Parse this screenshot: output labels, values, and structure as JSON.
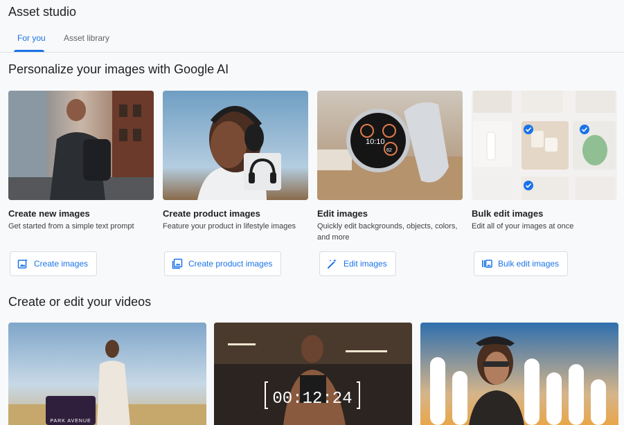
{
  "app": {
    "title": "Asset studio"
  },
  "tabs": [
    {
      "label": "For you",
      "active": true
    },
    {
      "label": "Asset library",
      "active": false
    }
  ],
  "images_section": {
    "title": "Personalize your images with Google AI",
    "cards": [
      {
        "title": "Create new images",
        "description": "Get started from a simple text prompt",
        "button": "Create images",
        "icon": "image-sparkle-icon"
      },
      {
        "title": "Create product images",
        "description": "Feature your product in lifestyle images",
        "button": "Create product images",
        "icon": "image-frame-icon"
      },
      {
        "title": "Edit images",
        "description": "Quickly edit backgrounds, objects, colors, and more",
        "button": "Edit images",
        "icon": "magic-wand-icon"
      },
      {
        "title": "Bulk edit images",
        "description": "Edit all of your images at once",
        "button": "Bulk edit images",
        "icon": "bulk-images-icon"
      }
    ]
  },
  "videos_section": {
    "title": "Create or edit your videos",
    "overlays": {
      "sign_text": "PARK AVENUE",
      "timer": "00:12:24"
    }
  },
  "watch_face": {
    "time": "10:10",
    "value": "62"
  },
  "colors": {
    "accent": "#1a73e8",
    "background": "#f8f9fa",
    "border": "#dadce0"
  }
}
